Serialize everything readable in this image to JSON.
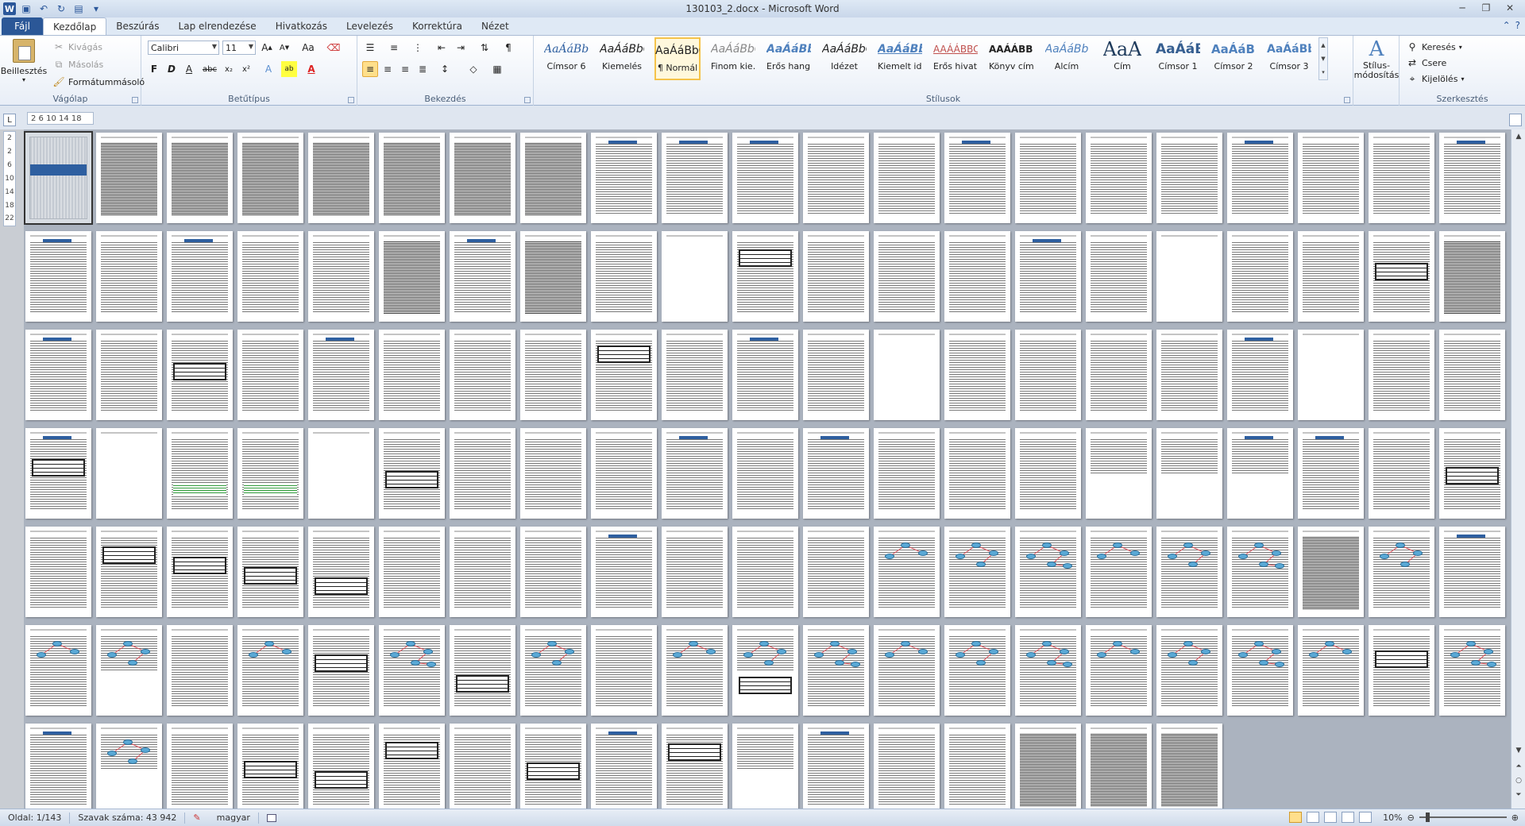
{
  "window": {
    "title": "130103_2.docx  -  Microsoft Word"
  },
  "qat": {
    "logo": "W"
  },
  "tabs": [
    "Fájl",
    "Kezdőlap",
    "Beszúrás",
    "Lap elrendezése",
    "Hivatkozás",
    "Levelezés",
    "Korrektúra",
    "Nézet"
  ],
  "ribbon": {
    "clipboard": {
      "label": "Vágólap",
      "paste": "Beillesztés",
      "cut": "Kivágás",
      "copy": "Másolás",
      "format_painter": "Formátummásoló"
    },
    "font": {
      "label": "Betűtípus",
      "name": "Calibri",
      "size": "11"
    },
    "paragraph": {
      "label": "Bekezdés"
    },
    "styles": {
      "label": "Stílusok",
      "items": [
        {
          "sample": "AaÁáBbC",
          "name": "Címsor 6"
        },
        {
          "sample": "AaÁáBbC",
          "name": "Kiemelés"
        },
        {
          "sample": "AaÁáBbC(",
          "name": "¶ Normál"
        },
        {
          "sample": "AaÁáBbC",
          "name": "Finom kie..."
        },
        {
          "sample": "AaÁáBbC",
          "name": "Erős hang..."
        },
        {
          "sample": "AaÁáBbC",
          "name": "Idézet"
        },
        {
          "sample": "AaÁáBbC",
          "name": "Kiemelt id..."
        },
        {
          "sample": "AAÁÁBBC(",
          "name": "Erős hivat..."
        },
        {
          "sample": "AAÁÁBBC(",
          "name": "Könyv címe"
        },
        {
          "sample": "AaÁáBb",
          "name": "Alcím"
        },
        {
          "sample": "AaA",
          "name": "Cím"
        },
        {
          "sample": "AaÁáBl",
          "name": "Címsor 1"
        },
        {
          "sample": "AaÁáBb",
          "name": "Címsor 2"
        },
        {
          "sample": "AaÁáBb(",
          "name": "Címsor 3"
        }
      ],
      "change_styles": "Stílus-\nmódosítás"
    },
    "editing": {
      "label": "Szerkesztés",
      "find": "Keresés",
      "replace": "Csere",
      "select": "Kijelölés"
    }
  },
  "ruler": {
    "corner": "L",
    "marks": "2  6  10  14 18"
  },
  "vruler": [
    "2",
    "2",
    "6",
    "10",
    "14",
    "18",
    "22"
  ],
  "status": {
    "page": "Oldal: 1/143",
    "words": "Szavak száma: 43 942",
    "language": "magyar",
    "zoom": "10%"
  },
  "document": {
    "page_count": 143,
    "columns": 21
  }
}
